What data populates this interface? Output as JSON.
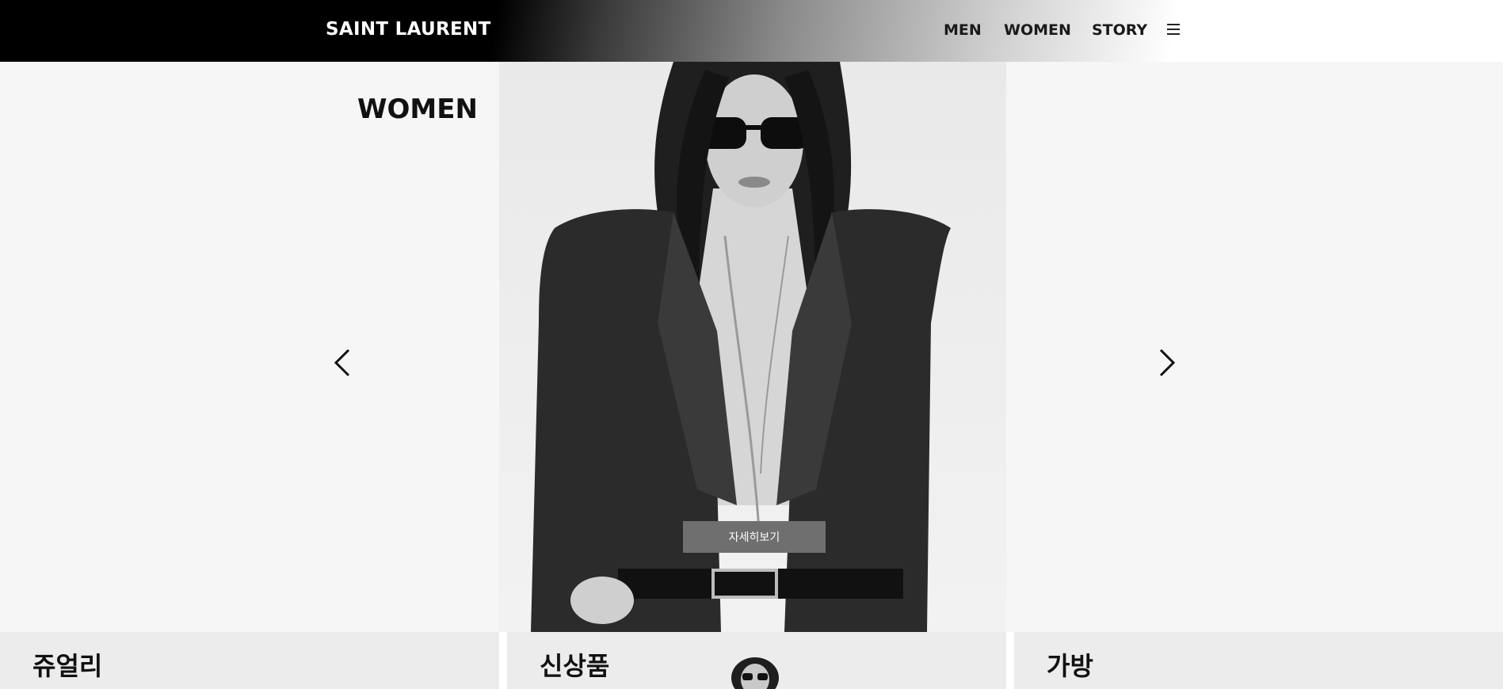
{
  "header": {
    "logo": "SAINT LAURENT",
    "nav": [
      "MEN",
      "WOMEN",
      "STORY"
    ],
    "menu_icon": "hamburger-menu-icon"
  },
  "hero": {
    "title": "WOMEN",
    "detail_button": "자세히보기",
    "prev_icon": "chevron-left-icon",
    "next_icon": "chevron-right-icon"
  },
  "categories": [
    {
      "label": "쥬얼리"
    },
    {
      "label": "신상품"
    },
    {
      "label": "가방"
    }
  ],
  "colors": {
    "header_dark": "#000000",
    "hero_bg": "#f6f6f6",
    "button_bg": "#6f6f6f",
    "category_bg": "#ececec"
  }
}
